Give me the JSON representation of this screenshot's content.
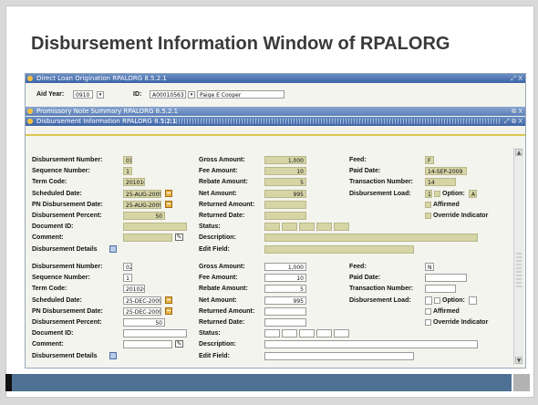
{
  "slide": {
    "title": "Disbursement Information Window of RPALORG"
  },
  "windows": {
    "main": "Direct Loan Origination  RPALORG  8.5.2.1",
    "promissory": "Promissory Note Summary  RPALORG  8.5.2.1",
    "disbursement": "Disbursement Information  RPALORG  8.5.2.1",
    "ctl_main": "⤢ X",
    "ctl_prom": "⧉ X",
    "ctl_disb": "⤢ ⧉ X"
  },
  "key": {
    "aid_year_label": "Aid Year:",
    "aid_year_value": "0910",
    "id_label": "ID:",
    "id_value": "A00010563",
    "name_value": "Paige E Cooper"
  },
  "labels": {
    "disb_number": "Disbursement Number:",
    "seq_number": "Sequence Number:",
    "term_code": "Term Code:",
    "sched_date": "Scheduled Date:",
    "pn_disb_date": "PN Disbursement Date:",
    "disb_percent": "Disbursement Percent:",
    "document_id": "Document ID:",
    "comment": "Comment:",
    "disb_details": "Disbursement Details",
    "gross": "Gross Amount:",
    "fee": "Fee Amount:",
    "rebate": "Rebate Amount:",
    "net": "Net Amount:",
    "returned_amount": "Returned Amount:",
    "returned_date": "Returned Date:",
    "status": "Status:",
    "description": "Description:",
    "edit_field": "Edit Field:",
    "feed": "Feed:",
    "paid_date": "Paid Date:",
    "trans_number": "Transaction Number:",
    "disb_load": "Disbursement Load:",
    "option": "Option:",
    "affirmed": "Affirmed",
    "override": "Override Indicator"
  },
  "records": [
    {
      "disb_number": "01",
      "seq_number": "1",
      "term_code": "201010",
      "sched_date": "25-AUG-2009",
      "pn_disb_date": "25-AUG-2009",
      "disb_percent": "50",
      "gross": "1,000",
      "fee": "10",
      "rebate": "5",
      "net": "995",
      "feed": "F",
      "paid_date": "14-SEP-2009",
      "trans_number": "14",
      "disb_load": "1",
      "option": "A"
    },
    {
      "disb_number": "02",
      "seq_number": "1",
      "term_code": "201020",
      "sched_date": "25-DEC-2009",
      "pn_disb_date": "25-DEC-2009",
      "disb_percent": "50",
      "gross": "1,000",
      "fee": "10",
      "rebate": "5",
      "net": "995",
      "feed": "N",
      "paid_date": "",
      "trans_number": "",
      "disb_load": "",
      "option": ""
    }
  ],
  "icons": [
    "calendar-icon",
    "edit-icon",
    "details-icon",
    "checkbox-icon",
    "scroll-up-icon",
    "scroll-down-icon"
  ],
  "colors": {
    "titlebar": "#3d63a6",
    "readonly_field": "#d6d5a6",
    "footer_bar": "#4f7193"
  }
}
